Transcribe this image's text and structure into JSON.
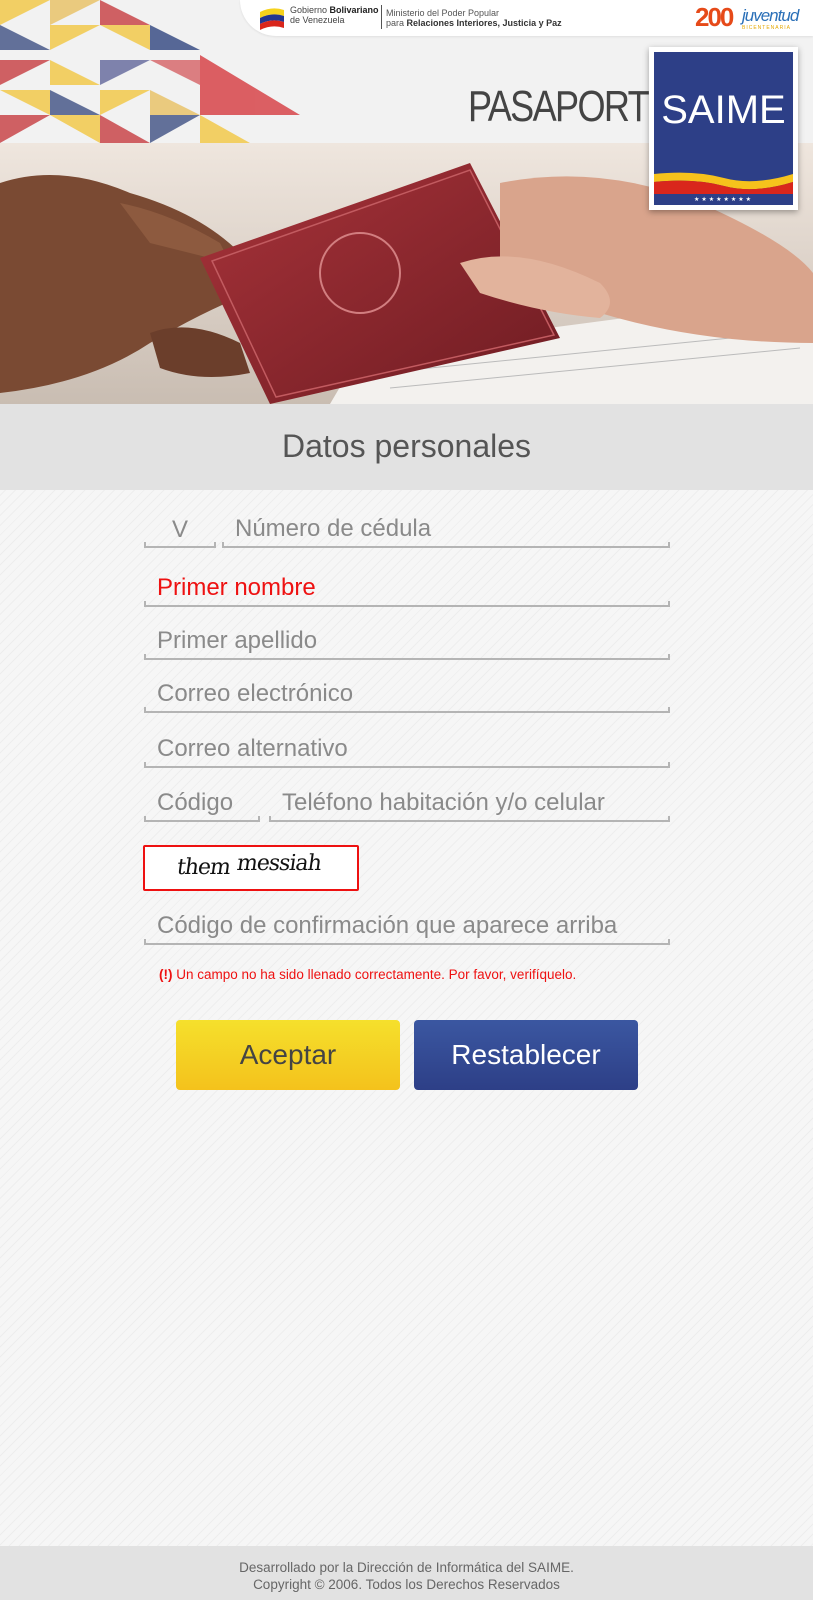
{
  "header": {
    "gov_line1_a": "Gobierno ",
    "gov_line1_b": "Bolivariano",
    "gov_line2": "de Venezuela",
    "ministry_line1": "Ministerio del Poder Popular",
    "ministry_line2_a": "para ",
    "ministry_line2_b": "Relaciones Interiores, Justicia y Paz",
    "juventud_number": "200",
    "juventud_word": "juventud",
    "juventud_sub": "BICENTENARIA",
    "banner_title": "PASAPORTE",
    "saime_logo": "SAIME",
    "saime_stars": "★★★★★★★★"
  },
  "section": {
    "title": "Datos personales"
  },
  "form": {
    "nationality_value": "V",
    "cedula_placeholder": "Número de cédula",
    "first_name_placeholder": "Primer nombre",
    "last_name_placeholder": "Primer apellido",
    "email_placeholder": "Correo electrónico",
    "alt_email_placeholder": "Correo alternativo",
    "code_placeholder": "Código",
    "phone_placeholder": "Teléfono habitación y/o celular",
    "captcha_word1": "them",
    "captcha_word2": "messiah",
    "captcha_input_placeholder": "Código de confirmación que aparece arriba",
    "error_prefix": "(!)",
    "error_message": " Un campo no ha sido llenado correctamente. Por favor, verifíquelo.",
    "accept_label": "Aceptar",
    "reset_label": "Restablecer"
  },
  "footer": {
    "line1": "Desarrollado por la Dirección de Informática del SAIME.",
    "line2": "Copyright © 2006. Todos los Derechos Reservados"
  },
  "colors": {
    "accent_blue": "#2d3f87",
    "accent_yellow": "#f4c21c",
    "error_red": "#ee1111"
  }
}
